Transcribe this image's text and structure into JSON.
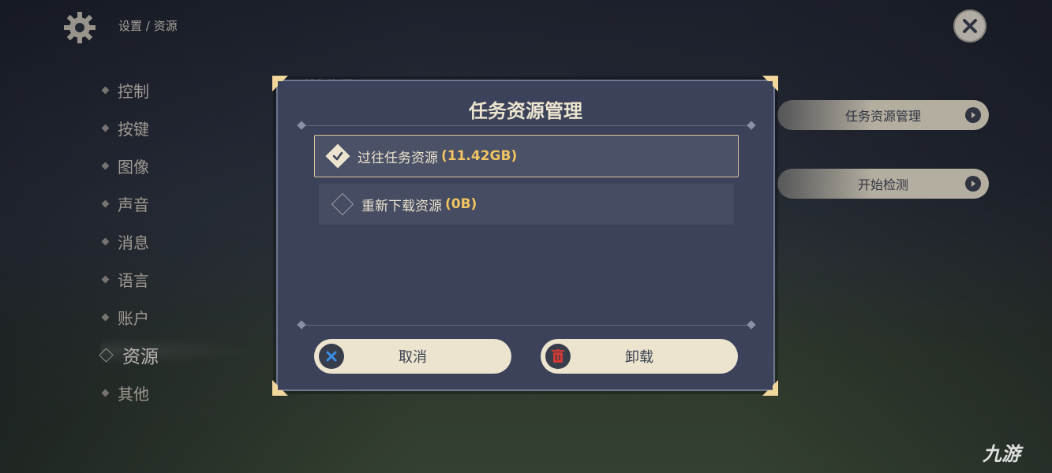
{
  "header": {
    "breadcrumb": "设置 / 资源"
  },
  "sidebar": {
    "items": [
      {
        "label": "控制"
      },
      {
        "label": "按键"
      },
      {
        "label": "图像"
      },
      {
        "label": "声音"
      },
      {
        "label": "消息"
      },
      {
        "label": "语言"
      },
      {
        "label": "账户"
      },
      {
        "label": "资源"
      },
      {
        "label": "其他"
      }
    ]
  },
  "background_panel": {
    "section_title": "任务资源",
    "manage_button": "任务资源管理",
    "check_button": "开始检测"
  },
  "dialog": {
    "title": "任务资源管理",
    "options": [
      {
        "label": "过往任务资源",
        "size": "(11.42GB)",
        "checked": true
      },
      {
        "label": "重新下载资源",
        "size": "(0B)",
        "checked": false
      }
    ],
    "cancel_label": "取消",
    "uninstall_label": "卸载"
  },
  "watermark": {
    "text": "九游"
  },
  "colors": {
    "accent_gold": "#f2c560",
    "panel": "#3b4259",
    "button_bg": "#ece4cf",
    "cancel_icon": "#3a8ee6",
    "uninstall_icon": "#d23b34"
  }
}
